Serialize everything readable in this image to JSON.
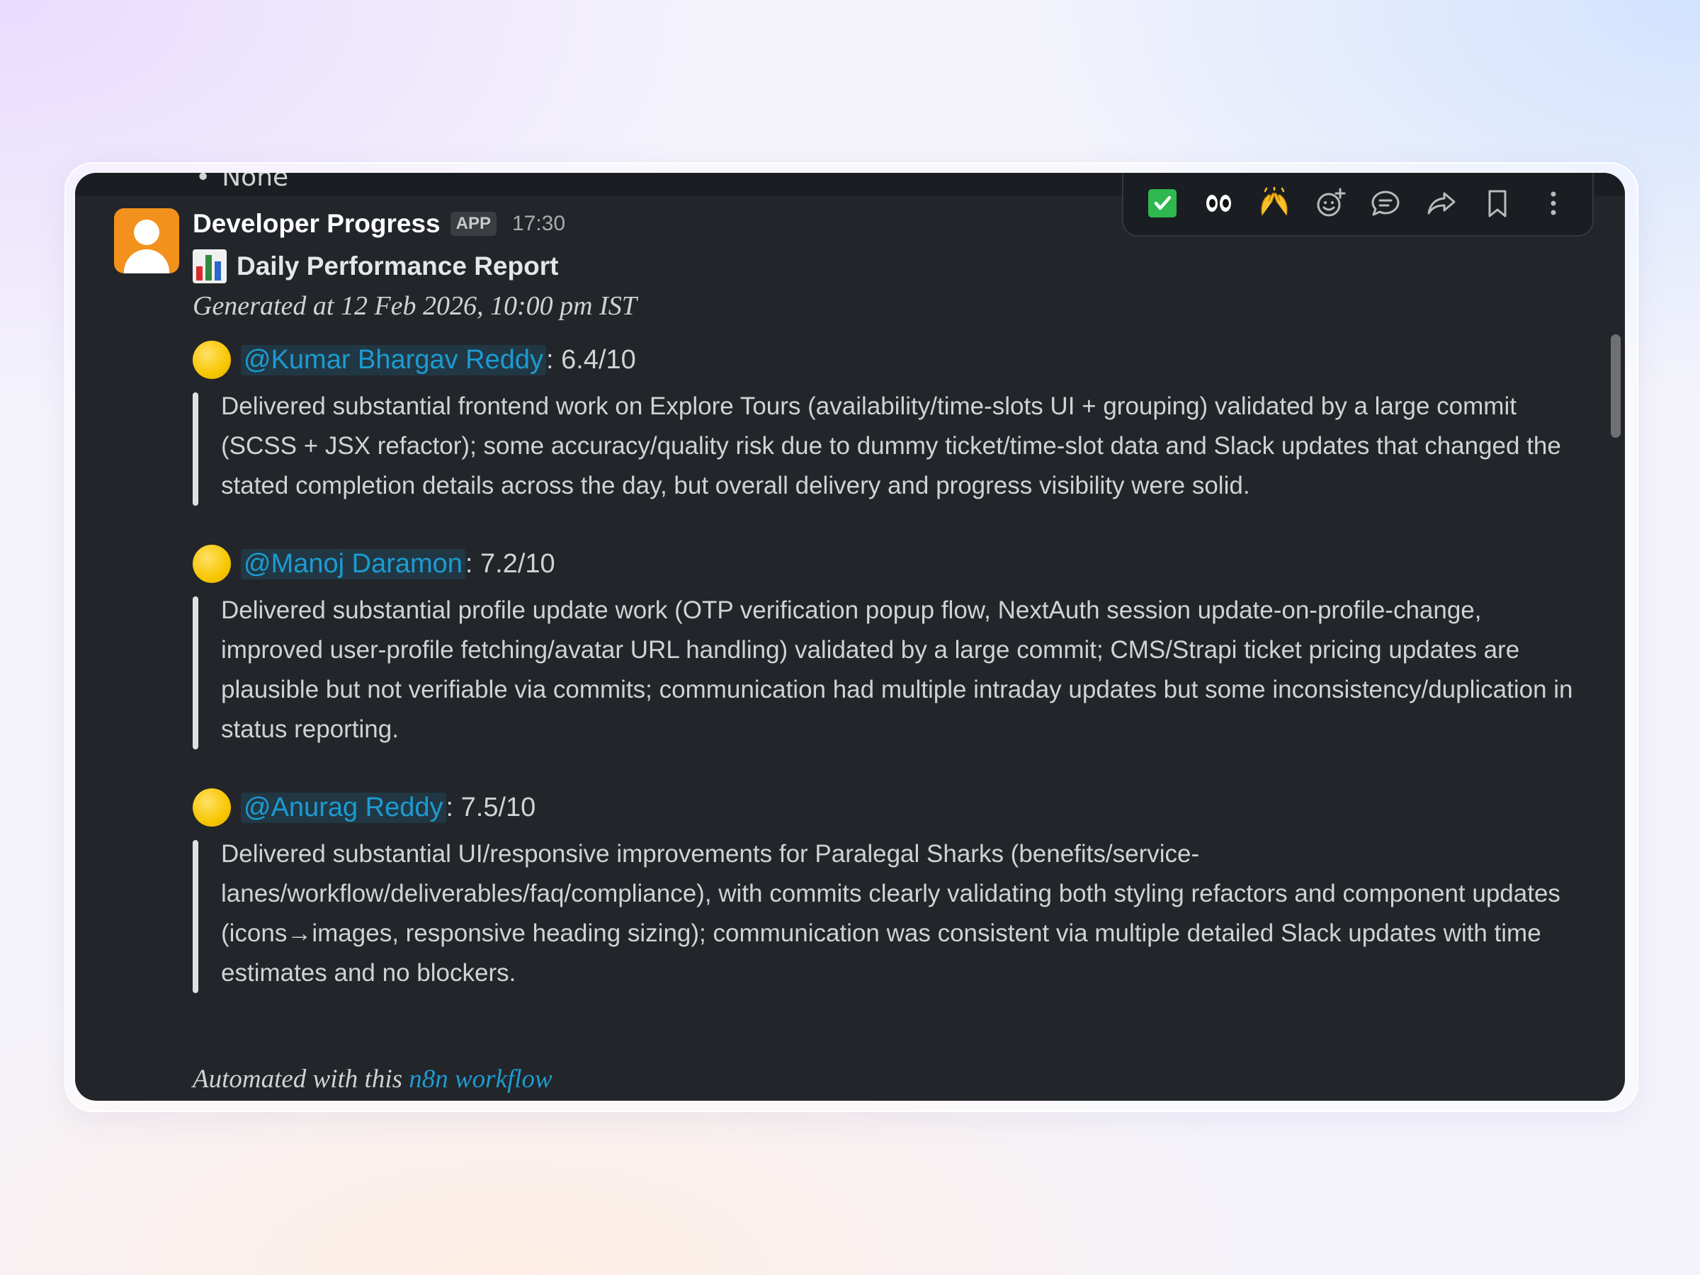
{
  "previous_message": {
    "bullet": "•",
    "text": "None"
  },
  "message": {
    "sender": "Developer Progress",
    "badge": "APP",
    "time": "17:30",
    "title": "Daily Performance Report",
    "generated": "Generated at 12 Feb 2026, 10:00 pm IST",
    "developers": [
      {
        "mention": "@Kumar Bhargav Reddy",
        "score": ": 6.4/10",
        "summary": "Delivered substantial frontend work on Explore Tours (availability/time-slots UI + grouping) validated by a large commit (SCSS + JSX refactor); some accuracy/quality risk due to dummy ticket/time-slot data and Slack updates that changed the stated completion details across the day, but overall delivery and progress visibility were solid."
      },
      {
        "mention": "@Manoj Daramon",
        "score": ": 7.2/10",
        "summary": "Delivered substantial profile update work (OTP verification popup flow, NextAuth session update-on-profile-change, improved user-profile fetching/avatar URL handling) validated by a large commit; CMS/Strapi ticket pricing updates are plausible but not verifiable via commits; communication had multiple intraday updates but some inconsistency/duplication in status reporting."
      },
      {
        "mention": "@Anurag Reddy",
        "score": ": 7.5/10",
        "summary": "Delivered substantial UI/responsive improvements for Paralegal Sharks (benefits/service-lanes/workflow/deliverables/faq/compliance), with commits clearly validating both styling refactors and component updates (icons→images, responsive heading sizing); communication was consistent via multiple detailed Slack updates with time estimates and no blockers."
      }
    ],
    "footer_text": "Automated with this ",
    "footer_link": "n8n workflow"
  },
  "toolbar": {
    "icons": [
      "white-check-mark-icon",
      "eyes-icon",
      "raised-hands-icon",
      "add-reaction-icon",
      "reply-in-thread-icon",
      "share-icon",
      "save-bookmark-icon",
      "more-actions-icon"
    ],
    "status_color": "#2eb84f",
    "mention_color": "#1d9bd1"
  }
}
